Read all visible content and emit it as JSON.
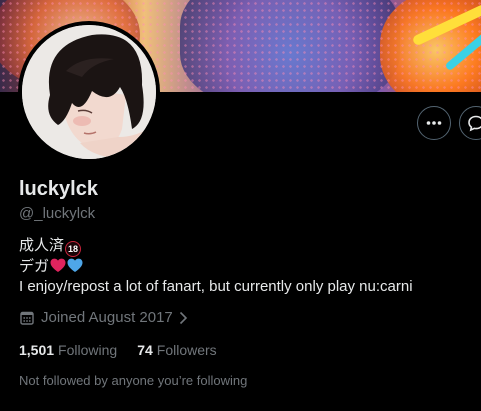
{
  "colors": {
    "background": "#000000",
    "text_primary": "#e7e9ea",
    "text_secondary": "#71767b",
    "button_border": "#536471",
    "heart_red": "#e0245e",
    "heart_blue": "#4ea6e8",
    "badge_red": "#c8233b"
  },
  "icons": {
    "more": "more-dots-icon",
    "message": "message-icon",
    "calendar": "calendar-icon",
    "chevron": "chevron-right-icon"
  },
  "profile": {
    "display_name": "luckylck",
    "handle": "@_luckylck",
    "bio": {
      "line1_text": "成人済",
      "line1_badge": "18",
      "line2_text": "デガ",
      "line3": "I enjoy/repost a lot of fanart, but currently only play nu:carni"
    },
    "joined": "Joined August 2017",
    "following_count": "1,501",
    "following_label": "Following",
    "followers_count": "74",
    "followers_label": "Followers",
    "followed_by": "Not followed by anyone you’re following"
  }
}
